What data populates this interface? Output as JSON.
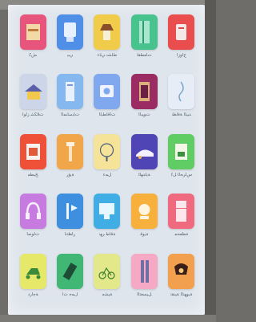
{
  "apps": [
    {
      "label": "ﺶﻛ",
      "color": "#e8557c",
      "icon": "cabinet-icon"
    },
    {
      "label": "ﻲﺒﺑ",
      "color": "#4f8fe8",
      "icon": "washbasin-icon"
    },
    {
      "label": "ﻁﺎﺸﻧ ﻲﻠﻋ",
      "color": "#f1cc4a",
      "icon": "lamp-icon"
    },
    {
      "label": "ﺕﺎﻌﻄﻘﻟ",
      "color": "#49c38e",
      "icon": "shower-icon"
    },
    {
      "label": "ﺝﺍﻭﺯﺃ",
      "color": "#ea4d4d",
      "icon": "kettle-icon"
    },
    {
      "label": "ﺕﻼﻜﺷ ﺯﺍﻮﻟ",
      "color": "#cdd6e8",
      "icon": "house-icon"
    },
    {
      "label": "ﺕﺎﺒﺳﺎﻨﻤﻟﺍ",
      "color": "#86b8f0",
      "icon": "building-icon"
    },
    {
      "label": "ﺕﺎﻗﺎﻄﺒﻟﺍ",
      "color": "#7fa8ef",
      "icon": "card-icon"
    },
    {
      "label": "ﺕﻮﻴﺒﻟﺍ",
      "color": "#9a2b63",
      "icon": "machine-icon"
    },
    {
      "label": "ﺪﻴﺒﻟﺍ ﺔﻓﺎﻈﻧ",
      "color": "#e6edf6",
      "icon": "hook-icon"
    },
    {
      "label": "ﺦﺒﻄﻣ",
      "color": "#ee5138",
      "icon": "oven-icon"
    },
    {
      "label": "ﺔﻳﺅﺭ",
      "color": "#f2a64a",
      "icon": "lamp-post-icon"
    },
    {
      "label": "ﻞﻤﻋ",
      "color": "#f5e39a",
      "icon": "fan-icon"
    },
    {
      "label": "ﺔﻳﺍﺪﻬﻟﺍ",
      "color": "#5045b4",
      "icon": "car-icon"
    },
    {
      "label": "ﺱﺍﺮﺤﻟﺍ ﻞﻛ",
      "color": "#60cc64",
      "icon": "coffee-machine-icon"
    },
    {
      "label": "ﺕﺍﻮﺻﺃ",
      "color": "#c77adf",
      "icon": "headphones-icon"
    },
    {
      "label": "ﺭﺎﻈﺘﻧﺍ",
      "color": "#3e8fdf",
      "icon": "tools-icon"
    },
    {
      "label": "ﺔﻗﺎﻃ ﺮﻬﻧ",
      "color": "#40aee4",
      "icon": "computer-icon"
    },
    {
      "label": "ﺔﻳﻮﻗ",
      "color": "#f7b03b",
      "icon": "scale-icon"
    },
    {
      "label": "ﺔﻈﻔﺤﻣ",
      "color": "#f06a7f",
      "icon": "fridge-icon"
    },
    {
      "label": "ﺔﺟﺍﺭﺩ",
      "color": "#e6e86a",
      "icon": "scooter-icon"
    },
    {
      "label": "ﻞﻤﺣ ﺕﺍ",
      "color": "#40b774",
      "icon": "drill-icon"
    },
    {
      "label": "ﺔﻴﺸﻣ",
      "color": "#e3e88a",
      "icon": "bicycle-icon"
    },
    {
      "label": "ﻞﻴﺴﻐﺘﻟﺍ",
      "color": "#f5a9c5",
      "icon": "pillar-icon"
    },
    {
      "label": "ﺔﻳﻮﻬﺘﻟﺍ ﺔﻴﻨﻘﺗ",
      "color": "#f2a04e",
      "icon": "lamp-shade-icon"
    }
  ]
}
